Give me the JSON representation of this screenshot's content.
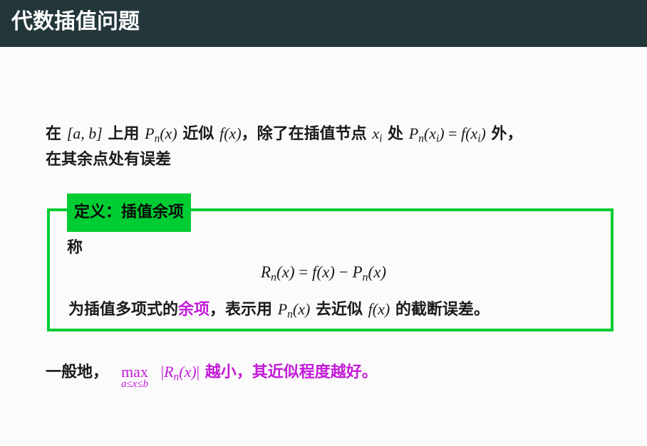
{
  "header": {
    "title": "代数插值问题"
  },
  "intro": {
    "t1": "在",
    "interval": "[a, b]",
    "t2": "上用",
    "pn_base": "P",
    "pn_sub": "n",
    "pn_arg": "(x)",
    "t3": "近似",
    "fx": "f(x)",
    "t4": "，除了在插值节点",
    "xi_base": "x",
    "xi_sub": "i",
    "t5": "处",
    "eq_lhs_base": "P",
    "eq_lhs_sub": "n",
    "eq_lhs_arg_open": "(x",
    "eq_lhs_arg_sub": "i",
    "eq_lhs_arg_close": ")",
    "eq_sign": " = ",
    "eq_rhs_f": "f(x",
    "eq_rhs_sub": "i",
    "eq_rhs_close": ")",
    "t6": "外，",
    "line2": "在其余点处有误差"
  },
  "definition": {
    "title": "定义：插值余项",
    "lead": "称",
    "formula": {
      "r_base": "R",
      "r_sub": "n",
      "r_arg": "(x)",
      "eq": " = ",
      "f": "f(x)",
      "minus": " − ",
      "p_base": "P",
      "p_sub": "n",
      "p_arg": "(x)"
    },
    "s1": "为插值多项式的",
    "highlight": "余项",
    "s2": "，表示用",
    "pn_base": "P",
    "pn_sub": "n",
    "pn_arg": "(x)",
    "s3": "去近似",
    "fx": "f(x)",
    "s4": "的截断误差。"
  },
  "conclusion": {
    "lead": "一般地，",
    "max_op": "max",
    "max_range": "a≤x≤b",
    "abs_open": "|",
    "r_base": "R",
    "r_sub": "n",
    "r_arg": "(x)",
    "abs_close": "|",
    "rest": "越小，其近似程度越好。"
  },
  "colors": {
    "header_bg": "#23373b",
    "box_green": "#00cc33",
    "highlight_purple": "#c21ad8"
  }
}
